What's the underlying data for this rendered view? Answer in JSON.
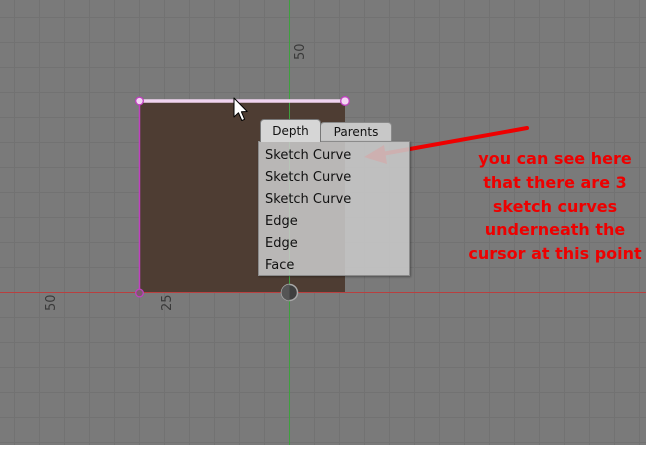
{
  "viewport": {
    "background_color": "#7a7a7a",
    "grid_color": "#727272",
    "axis_x_color": "#b84040",
    "axis_y_color": "#3ea03e",
    "sketch_face_color": "#4e3d33",
    "sketch_line_color": "#c040c0",
    "selected_line_color": "#f0d4f0",
    "tick_labels": {
      "y_axis_50": "50",
      "x_axis_50": "50",
      "x_axis_25": "25"
    }
  },
  "selection_popup": {
    "tabs": {
      "depth_label": "Depth",
      "parents_label": "Parents",
      "active": "Depth"
    },
    "items": [
      {
        "label": "Sketch Curve"
      },
      {
        "label": "Sketch Curve"
      },
      {
        "label": "Sketch Curve"
      },
      {
        "label": "Edge"
      },
      {
        "label": "Edge"
      },
      {
        "label": "Face"
      }
    ]
  },
  "annotation": {
    "text": "you can see here that there are 3 sketch curves underneath the cursor at this point",
    "color": "#ee0000"
  }
}
